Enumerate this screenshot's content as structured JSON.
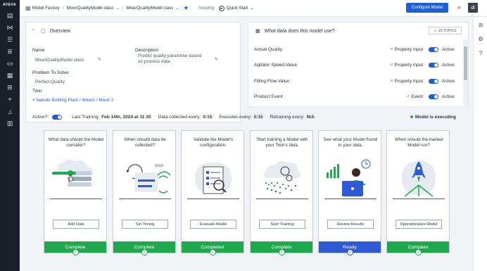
{
  "app": {
    "logo": "AVEVA"
  },
  "breadcrumb": {
    "root": "Model Factory",
    "parent": "MixerQualityModel class",
    "current": "MixerQualityModel class",
    "viewing_label": "Viewing:",
    "viewing_value": "Quick Start"
  },
  "header": {
    "configure_label": "Configure Model",
    "avatar_initials": "di"
  },
  "overview": {
    "title": "Overview",
    "name_label": "Name",
    "name_value": "MixerQualityModel class",
    "description_label": "Description",
    "description_value": "Predict quality parameter based on process data.",
    "problem_label": "Problem To Solve",
    "problem_value": "Perfect Quality",
    "twin_label": "Twin",
    "twin_value": "Nairobi Bottling Plant / Mixers / Mixer 2"
  },
  "data_panel": {
    "title": "What data does this model use?",
    "topics_label": "15 TOPICS",
    "rows": [
      {
        "name": "Actual Quality",
        "type": "Property input",
        "status": "Active"
      },
      {
        "name": "Agitator Speed.Value",
        "type": "Property input",
        "status": "Active"
      },
      {
        "name": "Filling Flow.Value",
        "type": "Property input",
        "status": "Active"
      },
      {
        "name": "Product Event",
        "type": "Event",
        "status": "Active"
      }
    ]
  },
  "status_bar": {
    "active_label": "Active?:",
    "last_training_label": "Last Training:",
    "last_training_value": "Feb 14th, 2024 at 11:35",
    "collected_label": "Data collected every:",
    "collected_value": "0:15",
    "executes_label": "Executes every:",
    "executes_value": "0:15",
    "retraining_label": "Retraining every:",
    "retraining_value": "N/A",
    "model_status": "Model is executing"
  },
  "steps": [
    {
      "question": "What data should the Model consider?",
      "button": "Add Data",
      "status": "Complete"
    },
    {
      "question": "When should data be collected?",
      "button": "Set Timing",
      "status": "Complete"
    },
    {
      "question": "Validate the Model's configuration.",
      "button": "Evaluate Model",
      "status": "Completed"
    },
    {
      "question": "Start training a Model with your Twin's data.",
      "button": "Start Training",
      "status": "Complete"
    },
    {
      "question": "See what your Model found in your data.",
      "button": "Review Results",
      "status": "Ready"
    },
    {
      "question": "When should the trained Model run?",
      "button": "Operationalize Model",
      "status": "Complete"
    }
  ],
  "colors": {
    "accent": "#1f5fd6",
    "complete": "#1fa84d",
    "ready": "#2e5ad6"
  }
}
